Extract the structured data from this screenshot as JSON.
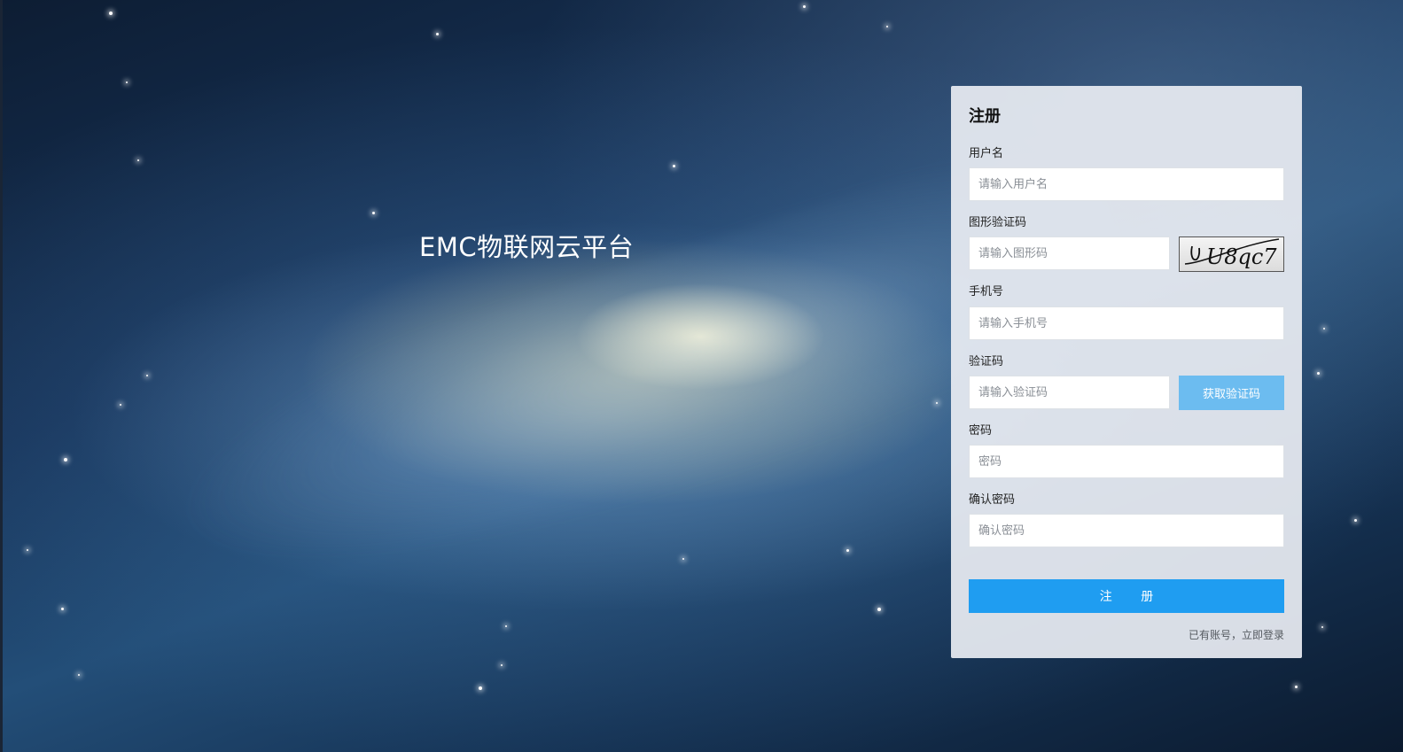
{
  "app": {
    "platform_title": "EMC物联网云平台"
  },
  "register_form": {
    "heading": "注册",
    "username": {
      "label": "用户名",
      "placeholder": "请输入用户名",
      "value": ""
    },
    "image_captcha": {
      "label": "图形验证码",
      "placeholder": "请输入图形码",
      "value": "",
      "captcha_text": "U8qc7"
    },
    "phone": {
      "label": "手机号",
      "placeholder": "请输入手机号",
      "value": ""
    },
    "sms_code": {
      "label": "验证码",
      "placeholder": "请输入验证码",
      "value": "",
      "button_label": "获取验证码"
    },
    "password": {
      "label": "密码",
      "placeholder": "密码",
      "value": ""
    },
    "confirm_password": {
      "label": "确认密码",
      "placeholder": "确认密码",
      "value": ""
    },
    "submit_label": "注 册",
    "login_link": "已有账号，立即登录"
  },
  "colors": {
    "primary_button": "#1f9df1",
    "secondary_button": "#6cbcf0",
    "panel_background": "#e8ecf2"
  }
}
